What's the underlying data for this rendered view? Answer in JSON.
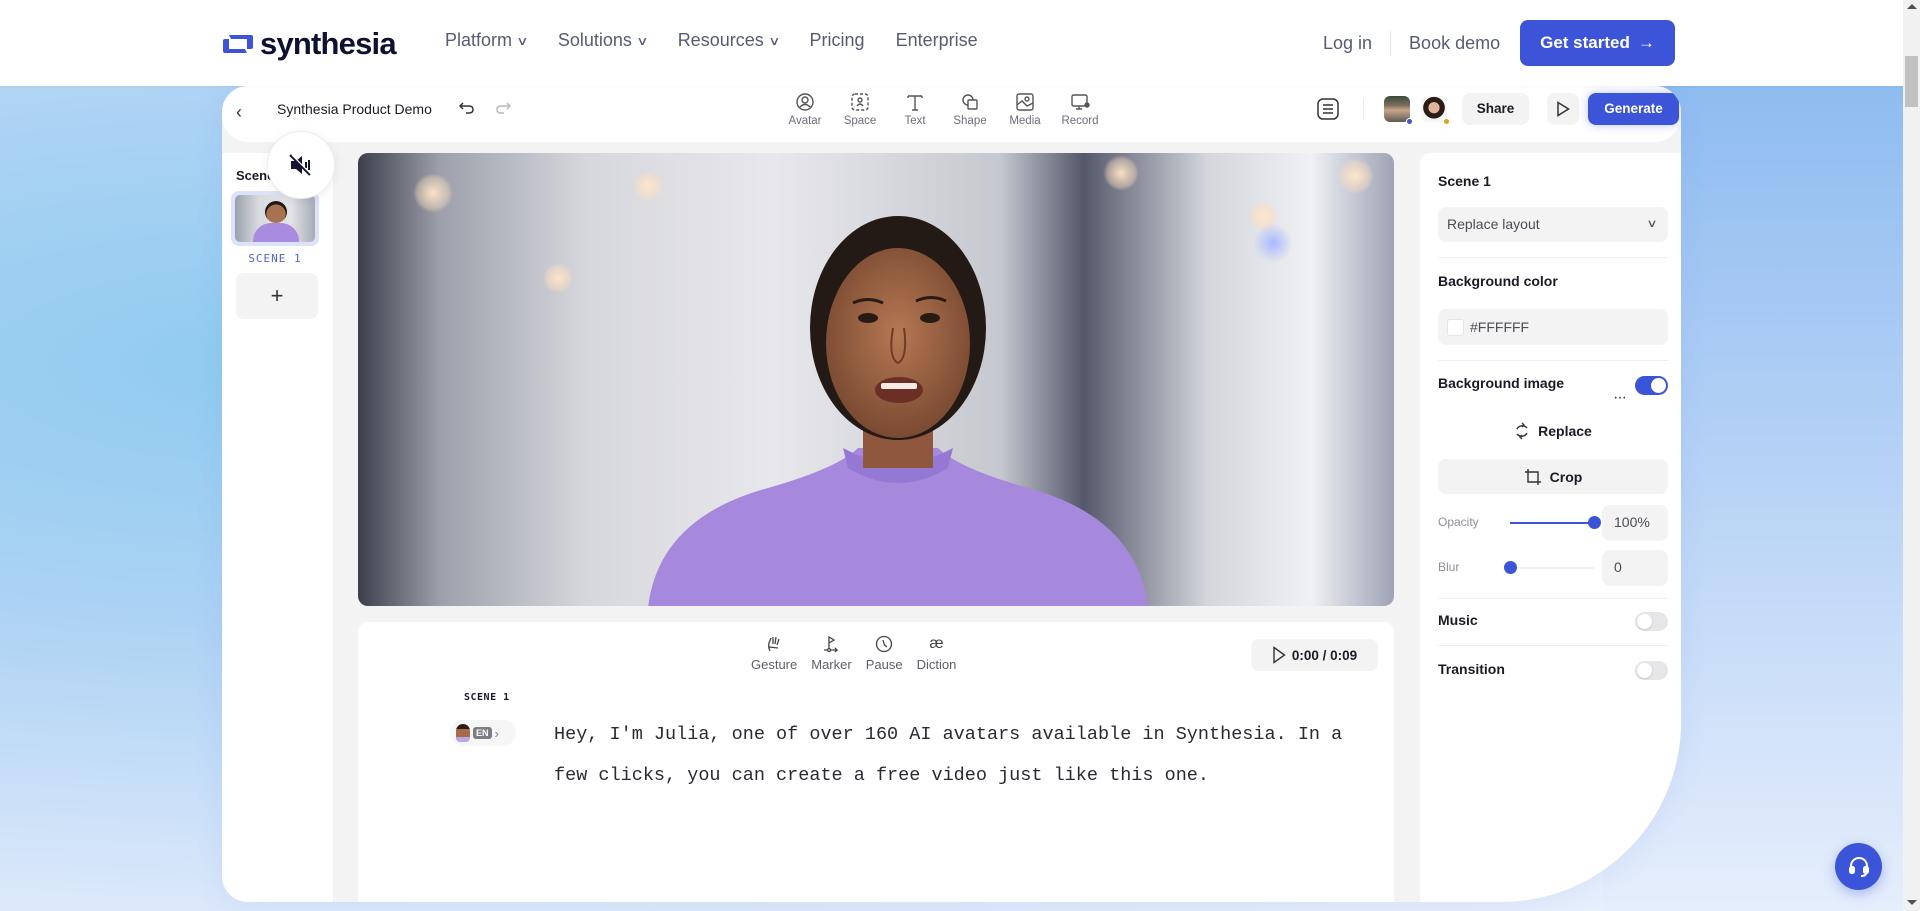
{
  "nav": {
    "brand": "synthesia",
    "links": [
      {
        "label": "Platform",
        "has_dropdown": true
      },
      {
        "label": "Solutions",
        "has_dropdown": true
      },
      {
        "label": "Resources",
        "has_dropdown": true
      },
      {
        "label": "Pricing",
        "has_dropdown": false
      },
      {
        "label": "Enterprise",
        "has_dropdown": false
      }
    ],
    "login": "Log in",
    "book_demo": "Book demo",
    "get_started": "Get started",
    "get_started_icon": "arrow-right-icon",
    "accent_color": "#3C55D8"
  },
  "editor": {
    "project_title": "Synthesia Product Demo",
    "toolbar": [
      {
        "label": "Avatar",
        "icon": "avatar-icon"
      },
      {
        "label": "Space",
        "icon": "space-icon"
      },
      {
        "label": "Text",
        "icon": "text-icon"
      },
      {
        "label": "Shape",
        "icon": "shape-icon"
      },
      {
        "label": "Media",
        "icon": "media-icon"
      },
      {
        "label": "Record",
        "icon": "record-icon"
      }
    ],
    "collaborators": [
      {
        "name": "collaborator-1",
        "status_color": "#3C55D8"
      },
      {
        "name": "collaborator-2",
        "status_color": "#E0A020"
      }
    ],
    "share": "Share",
    "generate": "Generate"
  },
  "scenes": {
    "title": "Scenes",
    "items": [
      {
        "label": "SCENE 1",
        "selected": true
      }
    ],
    "add_label": "+"
  },
  "script": {
    "tools": [
      {
        "label": "Gesture",
        "icon": "gesture-icon"
      },
      {
        "label": "Marker",
        "icon": "marker-icon"
      },
      {
        "label": "Pause",
        "icon": "clock-icon"
      },
      {
        "label": "Diction",
        "icon": "ae-ligature-icon",
        "glyph": "æ"
      }
    ],
    "time": "0:00 / 0:09",
    "scene_label": "SCENE 1",
    "language": "EN",
    "text": "Hey, I'm Julia, one of over 160 AI avatars available in Synthesia. In a few clicks, you can create a free video just like this one."
  },
  "properties": {
    "scene_title": "Scene 1",
    "layout_select": "Replace layout",
    "bg_color_label": "Background color",
    "bg_color_value": "#FFFFFF",
    "bg_image_label": "Background image",
    "bg_image_enabled": true,
    "more_glyph": "···",
    "replace": "Replace",
    "crop": "Crop",
    "opacity_label": "Opacity",
    "opacity_value": "100%",
    "opacity_fraction": 1.0,
    "blur_label": "Blur",
    "blur_value": "0",
    "blur_fraction": 0.0,
    "music_label": "Music",
    "music_enabled": false,
    "transition_label": "Transition",
    "transition_enabled": false
  }
}
